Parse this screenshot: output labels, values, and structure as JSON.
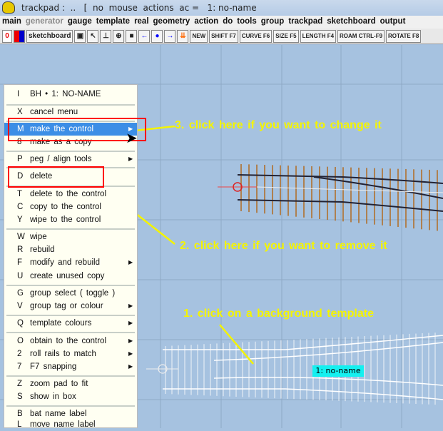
{
  "title": "trackpad :  ..   [  no  mouse  actions  ac =   1: no-name",
  "menubar": [
    "main",
    "generator",
    "gauge",
    "template",
    "real",
    "geometry",
    "action",
    "do",
    "tools",
    "group",
    "trackpad",
    "sketchboard",
    "output"
  ],
  "toolbar": {
    "zero": "0",
    "sketchboard": "sketchboard",
    "buttons": [
      "NEW",
      "SHIFT F7",
      "CURVE F6",
      "SIZE F5",
      "LENGTH F4",
      "ROAM CTRL-F9",
      "ROTATE F8"
    ]
  },
  "menu": {
    "items": [
      {
        "key": "I",
        "label": "BH •  1: NO-NAME"
      },
      {
        "key": "X",
        "label": "cancel menu"
      },
      {
        "key": "M",
        "label": "make the control",
        "highlight": true,
        "submenu": true
      },
      {
        "key": "8",
        "label": "make as a copy"
      },
      {
        "key": "P",
        "label": "peg / align tools",
        "submenu": true
      },
      {
        "key": "D",
        "label": "delete"
      },
      {
        "key": "T",
        "label": "delete to the control"
      },
      {
        "key": "C",
        "label": "copy to the control"
      },
      {
        "key": "Y",
        "label": "wipe to the control"
      },
      {
        "key": "W",
        "label": "wipe"
      },
      {
        "key": "R",
        "label": "rebuild"
      },
      {
        "key": "F",
        "label": "modify and rebuild",
        "submenu": true
      },
      {
        "key": "U",
        "label": "create unused copy"
      },
      {
        "key": "G",
        "label": "group select ( toggle )"
      },
      {
        "key": "V",
        "label": "group tag or colour",
        "submenu": true
      },
      {
        "key": "Q",
        "label": "template colours",
        "submenu": true
      },
      {
        "key": "O",
        "label": "obtain to the control",
        "submenu": true
      },
      {
        "key": "2",
        "label": "roll rails to match",
        "submenu": true
      },
      {
        "key": "7",
        "label": "F7 snapping",
        "submenu": true
      },
      {
        "key": "Z",
        "label": "zoom pad to fit"
      },
      {
        "key": "S",
        "label": "show in box"
      },
      {
        "key": "B",
        "label": "bat name label"
      },
      {
        "key": "L",
        "label": "move name label"
      }
    ]
  },
  "annotations": {
    "step3": "3. click here if you want to change it",
    "step2": "2. click here if you want to remove it",
    "step1": "1. click on a background template"
  },
  "template_label": "1: no-name",
  "colors": {
    "highlight": "#3c8ee6",
    "annotation": "#f4f400",
    "label": "#14f0f0",
    "background": "#a6c2e0"
  }
}
